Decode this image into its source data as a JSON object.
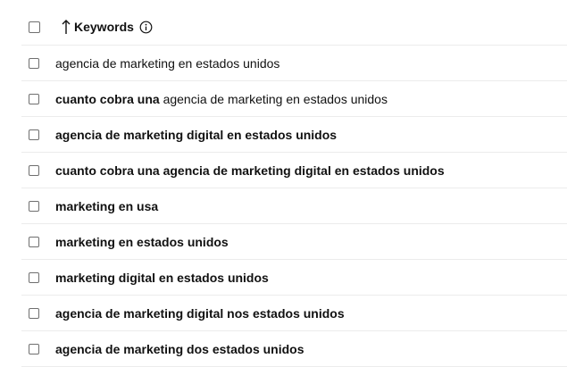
{
  "header": {
    "column_label": "Keywords",
    "sort_icon": "arrow-up-icon",
    "info_icon": "info-circle-icon"
  },
  "rows": [
    {
      "bold": "",
      "normal": "agencia de marketing en estados unidos"
    },
    {
      "bold": "cuanto cobra una",
      "normal": " agencia de marketing en estados unidos"
    },
    {
      "bold": "agencia de marketing digital en estados unidos",
      "normal": ""
    },
    {
      "bold": "cuanto cobra una agencia de marketing digital en estados unidos",
      "normal": ""
    },
    {
      "bold": "marketing en usa",
      "normal": ""
    },
    {
      "bold": "marketing en estados unidos",
      "normal": ""
    },
    {
      "bold": "marketing digital en estados unidos",
      "normal": ""
    },
    {
      "bold": "agencia de marketing digital nos estados unidos",
      "normal": ""
    },
    {
      "bold": "agencia de marketing dos estados unidos",
      "normal": ""
    }
  ]
}
